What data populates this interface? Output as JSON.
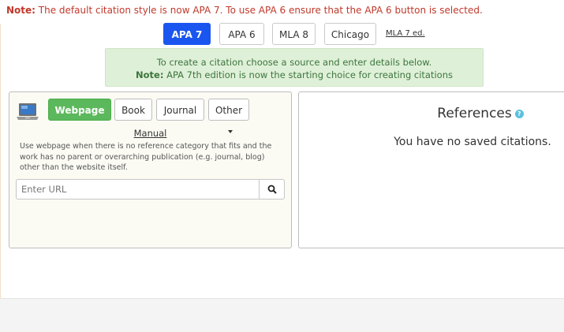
{
  "notice": {
    "label": "Note:",
    "text": "The default citation style is now APA 7. To use APA 6 ensure that the APA 6 button is selected."
  },
  "styles": {
    "buttons": [
      "APA 7",
      "APA 6",
      "MLA 8",
      "Chicago"
    ],
    "selected": "APA 7",
    "link": "MLA 7 ed."
  },
  "info": {
    "line1": "To create a citation choose a source and enter details below.",
    "note_label": "Note:",
    "note_text": "APA 7th edition is now the starting choice for creating citations"
  },
  "source": {
    "icon": "laptop-icon",
    "buttons": [
      "Webpage",
      "Book",
      "Journal",
      "Other"
    ],
    "selected": "Webpage",
    "manual": "Manual",
    "help": "Use webpage when there is no reference category that fits and the work has no parent or overarching publication (e.g. journal, blog) other than the website itself.",
    "url_placeholder": "Enter URL",
    "search_icon": "search-icon"
  },
  "references": {
    "title": "References",
    "help_icon": "question-circle-icon",
    "empty": "You have no saved citations."
  },
  "colors": {
    "notice_red": "#c0392b",
    "apa_blue": "#1a55f0",
    "webpage_green": "#5cb85c",
    "info_bg": "#dff0d8",
    "info_text": "#3c763d"
  }
}
